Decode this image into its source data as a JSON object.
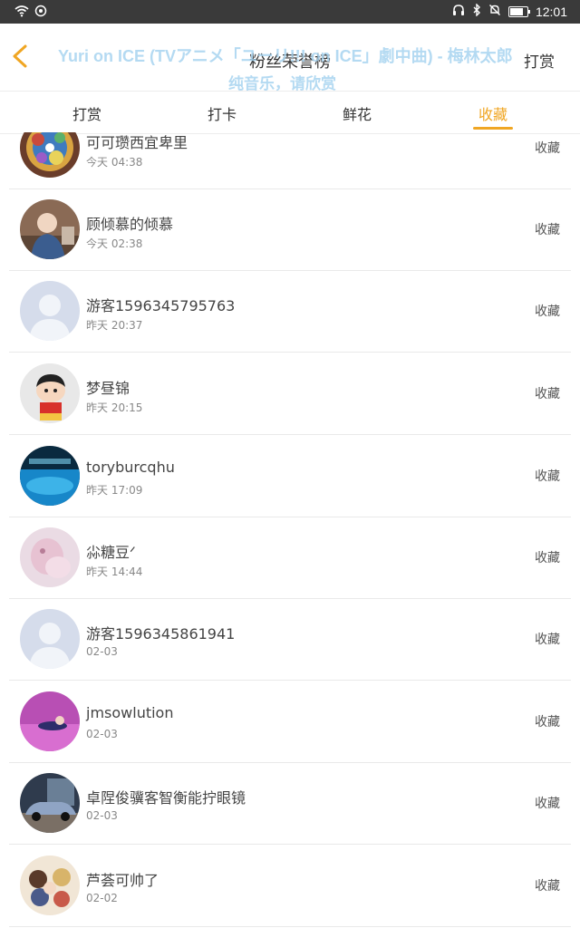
{
  "status_bar": {
    "time": "12:01",
    "battery_level": 0.8
  },
  "header": {
    "title": "粉丝荣誉榜",
    "right_action": "打赏",
    "music_overlay_line1": "Yuri on ICE (TVアニメ「ユーリ!!! on ICE」劇中曲) - 梅林太郎",
    "music_overlay_line2": "纯音乐，请欣赏"
  },
  "tabs": [
    {
      "label": "打赏",
      "active": false
    },
    {
      "label": "打卡",
      "active": false
    },
    {
      "label": "鲜花",
      "active": false
    },
    {
      "label": "收藏",
      "active": true
    }
  ],
  "accent_color": "#f0a623",
  "list": [
    {
      "name": "可可瓒西宜卑里",
      "time": "今天 04:38",
      "action": "收藏",
      "avatar": "colorful-art"
    },
    {
      "name": "顾倾慕的倾慕",
      "time": "今天 02:38",
      "action": "收藏",
      "avatar": "child-photo"
    },
    {
      "name": "游客1596345795763",
      "time": "昨天 20:37",
      "action": "收藏",
      "avatar": "default-person"
    },
    {
      "name": "梦昼锦",
      "time": "昨天 20:15",
      "action": "收藏",
      "avatar": "cartoon-boy"
    },
    {
      "name": "toryburcqhu",
      "time": "昨天 17:09",
      "action": "收藏",
      "avatar": "blue-water"
    },
    {
      "name": "尛糖豆ᐟ",
      "time": "昨天 14:44",
      "action": "收藏",
      "avatar": "pink-plush"
    },
    {
      "name": "游客1596345861941",
      "time": "02-03",
      "action": "收藏",
      "avatar": "default-person"
    },
    {
      "name": "jmsowlution",
      "time": "02-03",
      "action": "收藏",
      "avatar": "purple-figure"
    },
    {
      "name": "卓陧俊骥客智衡能拧眼镜",
      "time": "02-03",
      "action": "收藏",
      "avatar": "car-photo"
    },
    {
      "name": "芦荟可帅了",
      "time": "02-02",
      "action": "收藏",
      "avatar": "anime-group"
    }
  ]
}
